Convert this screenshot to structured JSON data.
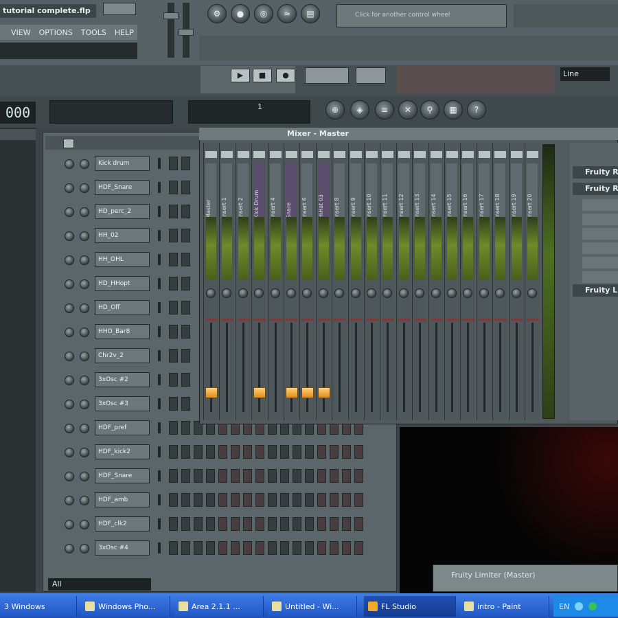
{
  "window": {
    "title": "tutorial complete.flp"
  },
  "menu": {
    "items": [
      "VIEW",
      "OPTIONS",
      "TOOLS",
      "HELP"
    ]
  },
  "hint": {
    "text": "Click for another control wheel"
  },
  "transport": {
    "time_display": "000",
    "bar_display": "1"
  },
  "pattern_mode": {
    "label": "Line"
  },
  "mixer": {
    "title": "Mixer - Master",
    "tracks": [
      "Master",
      "Insert 1",
      "Insert 2",
      "Kick Drum",
      "Insert 4",
      "Snare",
      "Insert 6",
      "HiHat 03",
      "Insert 8",
      "Insert 9",
      "Insert 10",
      "Insert 11",
      "Insert 12",
      "Insert 13",
      "Insert 14",
      "Insert 15",
      "Insert 16",
      "Insert 17",
      "Insert 18",
      "Insert 19",
      "Insert 20"
    ],
    "fx_slots": [
      "Fruity R",
      "Fruity R",
      "Fruity L"
    ]
  },
  "channels": {
    "names": [
      "Kick drum",
      "HDF_Snare",
      "HD_perc_2",
      "HH_02",
      "HH_OHL",
      "HD_HHopt",
      "HD_Off",
      "HHO_Bar8",
      "Chr2v_2",
      "3xOsc #2",
      "3xOsc #3",
      "HDF_pref",
      "HDF_kick2",
      "HDF_Snare",
      "HDF_amb",
      "HDF_clk2",
      "3xOsc #4"
    ],
    "filter": "All"
  },
  "limiter": {
    "title": "Fruity Limiter (Master)"
  },
  "taskbar": {
    "items": [
      "3 Windows",
      "Windows Pho...",
      "Area 2.1.1 ...",
      "Untitled - Wi...",
      "FL Studio",
      "intro - Paint"
    ],
    "lang": "EN"
  }
}
